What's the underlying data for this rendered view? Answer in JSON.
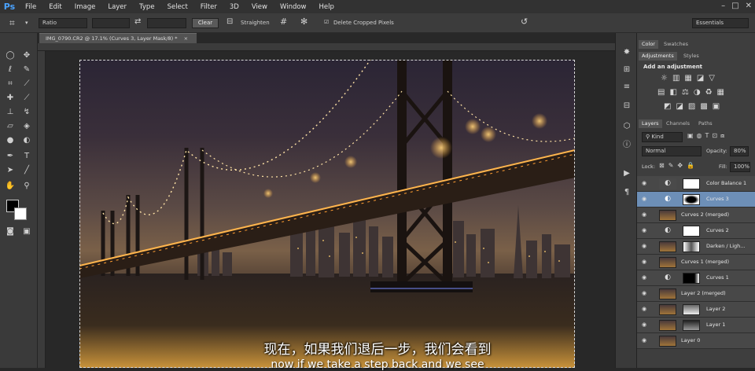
{
  "app": {
    "logo": "Ps"
  },
  "menu": [
    "File",
    "Edit",
    "Image",
    "Layer",
    "Type",
    "Select",
    "Filter",
    "3D",
    "View",
    "Window",
    "Help"
  ],
  "options_bar": {
    "ratio_select": "Ratio",
    "clear_label": "Clear",
    "straighten_label": "Straighten",
    "delete_cropped_label": "Delete Cropped Pixels",
    "workspace_select": "Essentials"
  },
  "document": {
    "tab_title": "IMG_0790.CR2 @ 17.1% (Curves 3, Layer Mask/8) *"
  },
  "panels": {
    "top_tabs": [
      "Color",
      "Swatches"
    ],
    "adj_tabs": [
      "Adjustments",
      "Styles"
    ],
    "adj_title": "Add an adjustment",
    "layer_tabs": [
      "Layers",
      "Channels",
      "Paths"
    ],
    "kind_select": "Kind",
    "blend_mode": "Normal",
    "opacity_label": "Opacity:",
    "opacity_value": "80%",
    "lock_label": "Lock:",
    "fill_label": "Fill:",
    "fill_value": "100%"
  },
  "layers": [
    {
      "name": "Color Balance 1",
      "type": "adjustment",
      "selected": false
    },
    {
      "name": "Curves 3",
      "type": "adjustment-mask",
      "selected": true
    },
    {
      "name": "Curves 2 (merged)",
      "type": "pixel",
      "selected": false
    },
    {
      "name": "Curves 2",
      "type": "adjustment",
      "selected": false
    },
    {
      "name": "Darken / Ligh...",
      "type": "pixel-mask",
      "selected": false
    },
    {
      "name": "Curves 1 (merged)",
      "type": "pixel",
      "selected": false
    },
    {
      "name": "Curves 1",
      "type": "adjustment-black",
      "selected": false
    },
    {
      "name": "Layer 2 (merged)",
      "type": "pixel",
      "selected": false
    },
    {
      "name": "Layer 2",
      "type": "pixel-mask",
      "selected": false
    },
    {
      "name": "Layer 1",
      "type": "pixel-mask2",
      "selected": false
    },
    {
      "name": "Layer 0",
      "type": "pixel",
      "selected": false
    }
  ],
  "subtitle": {
    "line1": "现在，如果我们退后一步，我们会看到",
    "line2": "now if we take a step back and we see"
  },
  "colors": {
    "selection_blue": "#6d8fb7",
    "logo_blue": "#4aa3ff"
  }
}
